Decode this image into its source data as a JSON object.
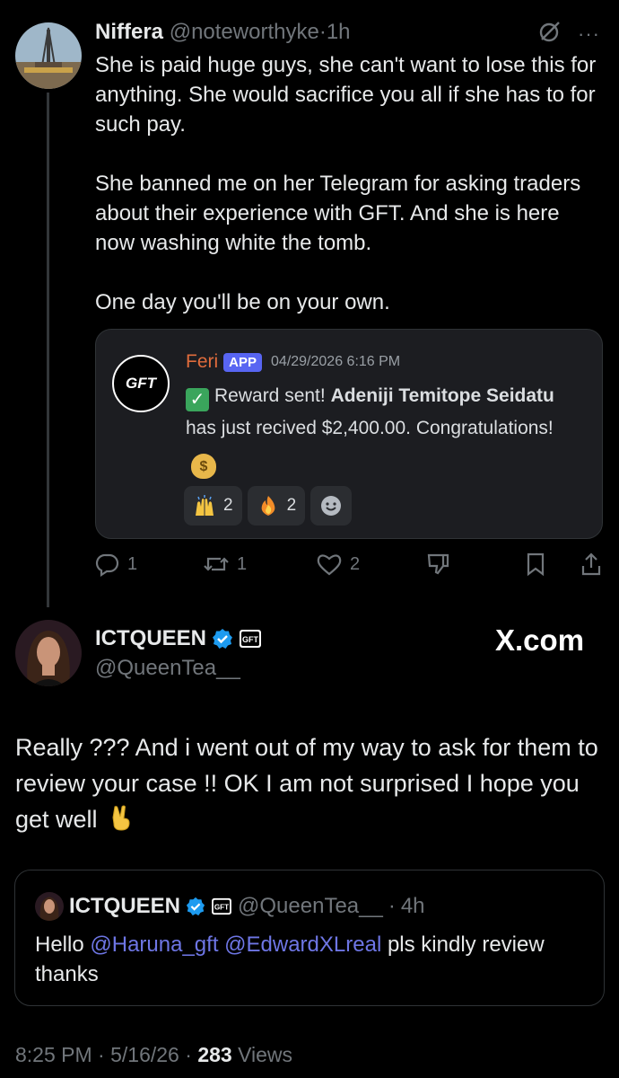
{
  "tweet1": {
    "name": "Niffera",
    "handle": "@noteworthyke",
    "sep": "·",
    "time": "1h",
    "paragraphs": [
      "She is paid huge guys, she can't want to lose this for anything. She would sacrifice you all if she has to for such pay.",
      "She banned me on her Telegram for asking traders about their experience with GFT. And she is here now washing white the tomb.",
      "One day you'll be on your own."
    ],
    "icons": [
      "grok-icon",
      "more-icon"
    ],
    "more": "···",
    "embed": {
      "logo_text": "GFT",
      "user": "Feri",
      "badge": "APP",
      "timestamp": "04/29/2026 6:16 PM",
      "msg_prefix": "Reward sent! ",
      "msg_bold": "Adeniji Temitope Seidatu",
      "msg_suffix": " has just recived $2,400.00. Congratulations!",
      "reactions": [
        {
          "emoji": "raising-hands",
          "count": "2"
        },
        {
          "emoji": "fire",
          "count": "2"
        }
      ]
    },
    "actions": {
      "replies": "1",
      "reposts": "1",
      "likes": "2"
    }
  },
  "tweet2": {
    "name": "ICTQUEEN",
    "handle": "@QueenTea__",
    "watermark": "X.com",
    "text": "Really ??? And i went out of my way to ask for them to review your case !! OK  I am not surprised I hope you get well",
    "quote": {
      "name": "ICTQUEEN",
      "handle": "@QueenTea__",
      "sep": "·",
      "time": "4h",
      "hello": "Hello",
      "mention1": "@Haruna_gft",
      "mention2": "@EdwardXLreal",
      "rest": "pls kindly review thanks"
    },
    "meta": {
      "time": "8:25 PM",
      "date": "5/16/26",
      "views": "283",
      "views_label": "Views",
      "sep": "·"
    }
  },
  "colors": {
    "background": "#000000",
    "text": "#e7e9ea",
    "muted": "#71767b",
    "mention": "#6e76e5",
    "verified": "#1d9bf0",
    "discord_user": "#e06c3c",
    "discord_badge": "#5865f2"
  }
}
